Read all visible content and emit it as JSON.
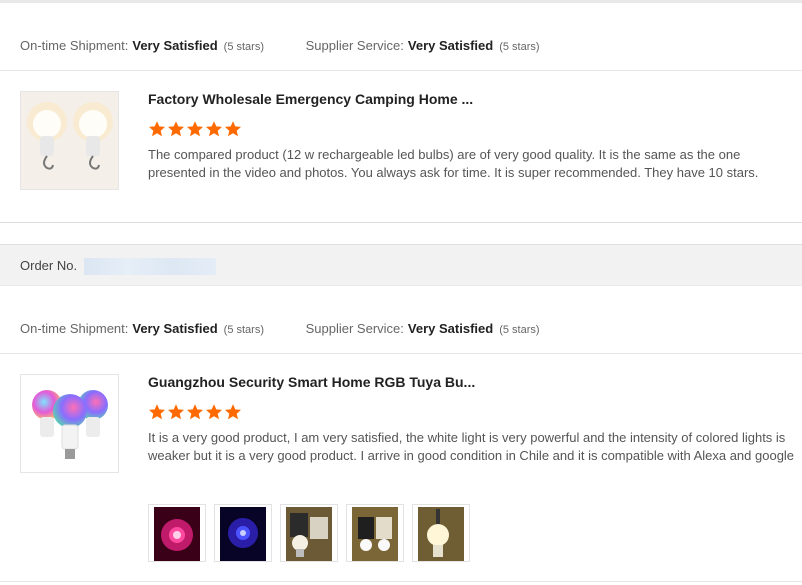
{
  "orders": [
    {
      "shipment_label": "On-time Shipment:",
      "shipment_value": "Very Satisfied",
      "shipment_stars_note": "(5 stars)",
      "supplier_label": "Supplier Service:",
      "supplier_value": "Very Satisfied",
      "supplier_stars_note": "(5 stars)",
      "product": {
        "title": "Factory Wholesale Emergency Camping Home ...",
        "rating": 5,
        "review": "The compared product (12 w rechargeable led bulbs) are of very good quality. It is the same as the one presented in the video and photos. You always ask for time. It is super recommended. They have 10 stars.",
        "thumb_icon": "rechargeable-bulbs-image"
      }
    },
    {
      "order_label": "Order No.",
      "shipment_label": "On-time Shipment:",
      "shipment_value": "Very Satisfied",
      "shipment_stars_note": "(5 stars)",
      "supplier_label": "Supplier Service:",
      "supplier_value": "Very Satisfied",
      "supplier_stars_note": "(5 stars)",
      "product": {
        "title": "Guangzhou Security Smart Home RGB Tuya Bu...",
        "rating": 5,
        "review": "It is a very good product, I am very satisfied, the white light is very powerful and the intensity of colored lights is weaker but it is a very good product.  I arrive in good condition in Chile and it is compatible with Alexa and google",
        "thumb_icon": "rgb-bulbs-image",
        "review_photos": [
          "pink-light-photo",
          "blue-light-photo",
          "bulb-box-photo-1",
          "bulb-box-photo-2",
          "bulb-lit-photo"
        ]
      }
    }
  ],
  "colors": {
    "star": "#ff6a00",
    "order_bar": "#f2f2f2"
  }
}
